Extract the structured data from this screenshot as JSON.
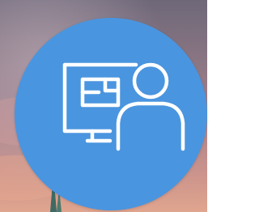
{
  "colors": {
    "accent_circle": "#4A95DF",
    "glyph_stroke": "#FFFFFF",
    "sky_top": "#6E6879",
    "sky_mid": "#9A7D88",
    "sky_low": "#C9928C",
    "sky_horizon": "#E0A58E"
  },
  "button": {
    "icon": "remote-worker-computer-icon"
  }
}
